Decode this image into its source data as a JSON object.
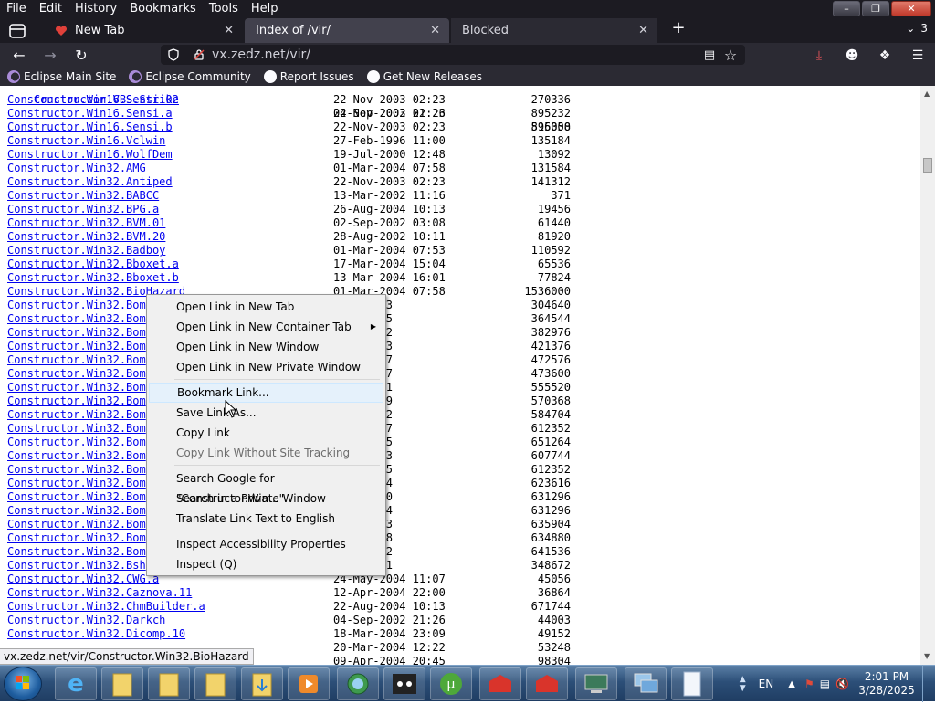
{
  "menubar": {
    "items": [
      "File",
      "Edit",
      "History",
      "Bookmarks",
      "Tools",
      "Help"
    ]
  },
  "tabs": [
    {
      "title": "New Tab",
      "state": "inactive"
    },
    {
      "title": "Index of /vir/",
      "state": "active"
    },
    {
      "title": "Blocked",
      "state": "inactive"
    }
  ],
  "tabs_count": "3",
  "navbar": {
    "url": "vx.zedz.net/vir/"
  },
  "bookmarks": [
    "Eclipse Main Site",
    "Eclipse Community",
    "Report Issues",
    "Get New Releases"
  ],
  "listing": {
    "top_row": {
      "name": "Constructor.VBS.Strike",
      "date": "04-Sep-2002 21:26",
      "size": "515358"
    },
    "rows": [
      {
        "name": "Constructor.Win16.Sensi.02",
        "date": "22-Nov-2003 02:23",
        "size": "270336"
      },
      {
        "name": "Constructor.Win16.Sensi.a",
        "date": "22-Nov-2003 02:23",
        "size": "895232"
      },
      {
        "name": "Constructor.Win16.Sensi.b",
        "date": "22-Nov-2003 02:23",
        "size": "896000"
      },
      {
        "name": "Constructor.Win16.Vclwin",
        "date": "27-Feb-1996 11:00",
        "size": "135184"
      },
      {
        "name": "Constructor.Win16.WolfDem",
        "date": "19-Jul-2000 12:48",
        "size": "13092"
      },
      {
        "name": "Constructor.Win32.AMG",
        "date": "01-Mar-2004 07:58",
        "size": "131584"
      },
      {
        "name": "Constructor.Win32.Antiped",
        "date": "22-Nov-2003 02:23",
        "size": "141312"
      },
      {
        "name": "Constructor.Win32.BABCC",
        "date": "13-Mar-2002 11:16",
        "size": "371"
      },
      {
        "name": "Constructor.Win32.BPG.a",
        "date": "26-Aug-2004 10:13",
        "size": "19456"
      },
      {
        "name": "Constructor.Win32.BVM.01",
        "date": "02-Sep-2002 03:08",
        "size": "61440"
      },
      {
        "name": "Constructor.Win32.BVM.20",
        "date": "28-Aug-2002 10:11",
        "size": "81920"
      },
      {
        "name": "Constructor.Win32.Badboy",
        "date": "01-Mar-2004 07:53",
        "size": "110592"
      },
      {
        "name": "Constructor.Win32.Bboxet.a",
        "date": "17-Mar-2004 15:04",
        "size": "65536"
      },
      {
        "name": "Constructor.Win32.Bboxet.b",
        "date": "13-Mar-2004 16:01",
        "size": "77824"
      },
      {
        "name": "Constructor.Win32.BioHazard",
        "date": "01-Mar-2004 07:58",
        "size": "1536000"
      },
      {
        "name": "Constructor.Win32.Bom",
        "date": "003 08:13",
        "size": "304640"
      },
      {
        "name": "Constructor.Win32.Bom",
        "date": "003 13:45",
        "size": "364544"
      },
      {
        "name": "Constructor.Win32.Bom",
        "date": "003 16:12",
        "size": "382976"
      },
      {
        "name": "Constructor.Win32.Bom",
        "date": "003 16:43",
        "size": "421376"
      },
      {
        "name": "Constructor.Win32.Bom",
        "date": "003 16:27",
        "size": "472576"
      },
      {
        "name": "Constructor.Win32.Bom",
        "date": "003 21:17",
        "size": "473600"
      },
      {
        "name": "Constructor.Win32.Bom",
        "date": "003 13:51",
        "size": "555520"
      },
      {
        "name": "Constructor.Win32.Bom",
        "date": "003 10:19",
        "size": "570368"
      },
      {
        "name": "Constructor.Win32.Bom",
        "date": "003 14:02",
        "size": "584704"
      },
      {
        "name": "Constructor.Win32.Bom",
        "date": "003 11:27",
        "size": "612352"
      },
      {
        "name": "Constructor.Win32.Bom",
        "date": "003 15:45",
        "size": "651264"
      },
      {
        "name": "Constructor.Win32.Bom",
        "date": "003 21:13",
        "size": "607744"
      },
      {
        "name": "Constructor.Win32.Bom",
        "date": "003 00:25",
        "size": "612352"
      },
      {
        "name": "Constructor.Win32.Bom",
        "date": "003 09:34",
        "size": "623616"
      },
      {
        "name": "Constructor.Win32.Bom",
        "date": "003 08:30",
        "size": "631296"
      },
      {
        "name": "Constructor.Win32.Bom",
        "date": "003 15:04",
        "size": "631296"
      },
      {
        "name": "Constructor.Win32.Bom",
        "date": "003 05:13",
        "size": "635904"
      },
      {
        "name": "Constructor.Win32.Bom",
        "date": "003 19:58",
        "size": "634880"
      },
      {
        "name": "Constructor.Win32.Bom",
        "date": "003 18:42",
        "size": "641536"
      },
      {
        "name": "Constructor.Win32.Bsh",
        "date": "003 18:21",
        "size": "348672"
      },
      {
        "name": "Constructor.Win32.CWG.a",
        "date": "24-May-2004 11:07",
        "size": "45056"
      },
      {
        "name": "Constructor.Win32.Caznova.11",
        "date": "12-Apr-2004 22:00",
        "size": "36864"
      },
      {
        "name": "Constructor.Win32.ChmBuilder.a",
        "date": "22-Aug-2004 10:13",
        "size": "671744"
      },
      {
        "name": "Constructor.Win32.Darkch",
        "date": "04-Sep-2002 21:26",
        "size": "44003"
      },
      {
        "name": "Constructor.Win32.Dicomp.10",
        "date": "18-Mar-2004 23:09",
        "size": "49152"
      },
      {
        "name": "",
        "date": "20-Mar-2004 12:22",
        "size": "53248"
      },
      {
        "name": "",
        "date": "09-Apr-2004 20:45",
        "size": "98304"
      }
    ]
  },
  "context_menu": {
    "items": [
      {
        "label": "Open Link in New Tab",
        "type": "item"
      },
      {
        "label": "Open Link in New Container Tab",
        "type": "submenu"
      },
      {
        "label": "Open Link in New Window",
        "type": "item"
      },
      {
        "label": "Open Link in New Private Window",
        "type": "item"
      },
      {
        "type": "separator"
      },
      {
        "label": "Bookmark Link...",
        "type": "item",
        "hover": true
      },
      {
        "label": "Save Link As...",
        "type": "item"
      },
      {
        "label": "Copy Link",
        "type": "item"
      },
      {
        "label": "Copy Link Without Site Tracking",
        "type": "disabled"
      },
      {
        "type": "separator"
      },
      {
        "label": "Search Google for \"Constructor.Win...\"",
        "type": "item"
      },
      {
        "label": "Search in a Private Window",
        "type": "item"
      },
      {
        "label": "Translate Link Text to English",
        "type": "item"
      },
      {
        "type": "separator"
      },
      {
        "label": "Inspect Accessibility Properties",
        "type": "item"
      },
      {
        "label": "Inspect (Q)",
        "type": "item"
      }
    ]
  },
  "status_url": "vx.zedz.net/vir/Constructor.Win32.BioHazard",
  "taskbar": {
    "language": "EN",
    "time": "2:01 PM",
    "date": "3/28/2025"
  },
  "colors": {
    "chrome_dark": "#1c1b22",
    "toolbar": "#2b2a33",
    "active_tab": "#42414d",
    "link": "#0000ee",
    "download_icon": "#ff5a5f"
  }
}
